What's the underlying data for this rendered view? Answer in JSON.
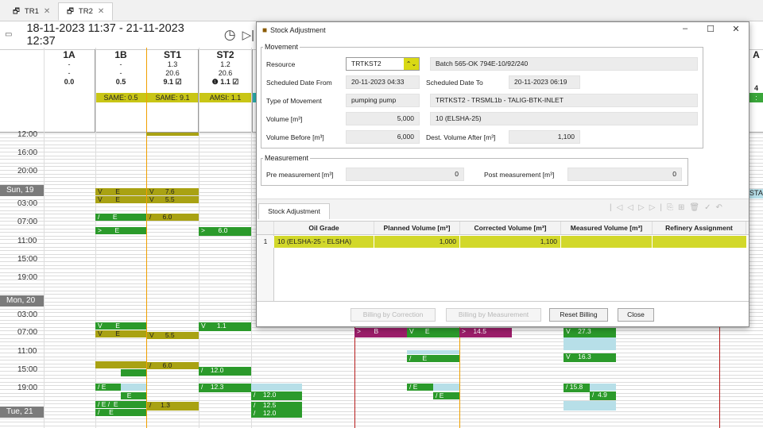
{
  "tabs": [
    {
      "label": "TR1"
    },
    {
      "label": "TR2"
    }
  ],
  "date_range": "18-11-2023 11:37 - 21-11-2023 12:37",
  "columns": [
    {
      "code": "1A",
      "l1": "-",
      "l2": "-",
      "l3": "0.0",
      "chip": ""
    },
    {
      "code": "1B",
      "l1": "-",
      "l2": "-",
      "l3": "0.5",
      "chip": "SAME: 0.5"
    },
    {
      "code": "ST1",
      "l1": "1.3",
      "l2": "20.6",
      "l3": "9.1",
      "chip": "SAME: 9.1"
    },
    {
      "code": "ST2",
      "l1": "1.2",
      "l2": "20.6",
      "l3": "1.1",
      "chip": "AMSI: 1.1"
    }
  ],
  "right_col": {
    "code": "A",
    "l3": "4",
    "chip": ": 0.4",
    "bar": "STA"
  },
  "hours": [
    "12:00",
    "16:00",
    "20:00",
    "03:00",
    "07:00",
    "11:00",
    "15:00",
    "19:00",
    "03:00",
    "07:00",
    "11:00",
    "15:00",
    "19:00"
  ],
  "days": [
    "Sun, 19",
    "Mon, 20",
    "Tue, 21"
  ],
  "bars": {
    "b1": "V",
    "b2": "E",
    "b3": "V",
    "b4": "7.6",
    "b5": "V",
    "b6": "E",
    "b7": "V",
    "b8": "5.5",
    "b9": "E",
    "b10": "6.0",
    "b11": "E",
    "b12": "6.0",
    "b13": "V",
    "b14": "E",
    "b15": "1.1",
    "b16": "V",
    "b17": "E",
    "b18": "5.5",
    "b19": "6.0",
    "b20": "12.0",
    "b21": "E",
    "b22": "12.3",
    "b23": "12.0",
    "b24": "E",
    "b25": "1.3",
    "b26": "E",
    "b27": "12.5",
    "b28": "12.0",
    "b29": "B",
    "b30": "E",
    "b31": "14.5",
    "b32": "27.3",
    "b33": "16.3",
    "b34": "E",
    "b35": "E",
    "b36": "15.8",
    "b37": "4.9",
    "b38": "V",
    "b39": "E",
    "b40": "E"
  },
  "dialog": {
    "title": "Stock Adjustment",
    "movement_legend": "Movement",
    "resource_label": "Resource",
    "resource_value": "TRTKST2",
    "batch": "Batch 565-OK 794E-10/92/240",
    "sched_from_label": "Scheduled Date From",
    "sched_from": "20-11-2023 04:33",
    "sched_to_label": "Scheduled Date To",
    "sched_to": "20-11-2023 06:19",
    "type_label": "Type of Movement",
    "type_value": "pumping pump",
    "type_desc": "TRTKST2 - TRSML1b - TALIG-BTK-INLET",
    "volume_label": "Volume [m³]",
    "volume_value": "5,000",
    "volume_desc": "10 (ELSHA-25)",
    "vol_before_label": "Volume Before [m³]",
    "vol_before": "6,000",
    "dest_after_label": "Dest. Volume After [m³]",
    "dest_after": "1,100",
    "measurement_legend": "Measurement",
    "pre_label": "Pre measurement [m³]",
    "pre_value": "0",
    "post_label": "Post measurement [m³]",
    "post_value": "0",
    "subtab": "Stock Adjustment",
    "table_headers": [
      "Oil Grade",
      "Planned Volume [m³]",
      "Corrected Volume [m³]",
      "Measured Volume [m³]",
      "Refinery Assignment"
    ],
    "rows": [
      {
        "num": "1",
        "grade": "10 (ELSHA-25 - ELSHA)",
        "planned": "1,000",
        "corrected": "1,100",
        "measured": "",
        "refinery": ""
      }
    ],
    "btn_corr": "Billing by Correction",
    "btn_meas": "Billing by Measurement",
    "btn_reset": "Reset Billing",
    "btn_close": "Close"
  }
}
